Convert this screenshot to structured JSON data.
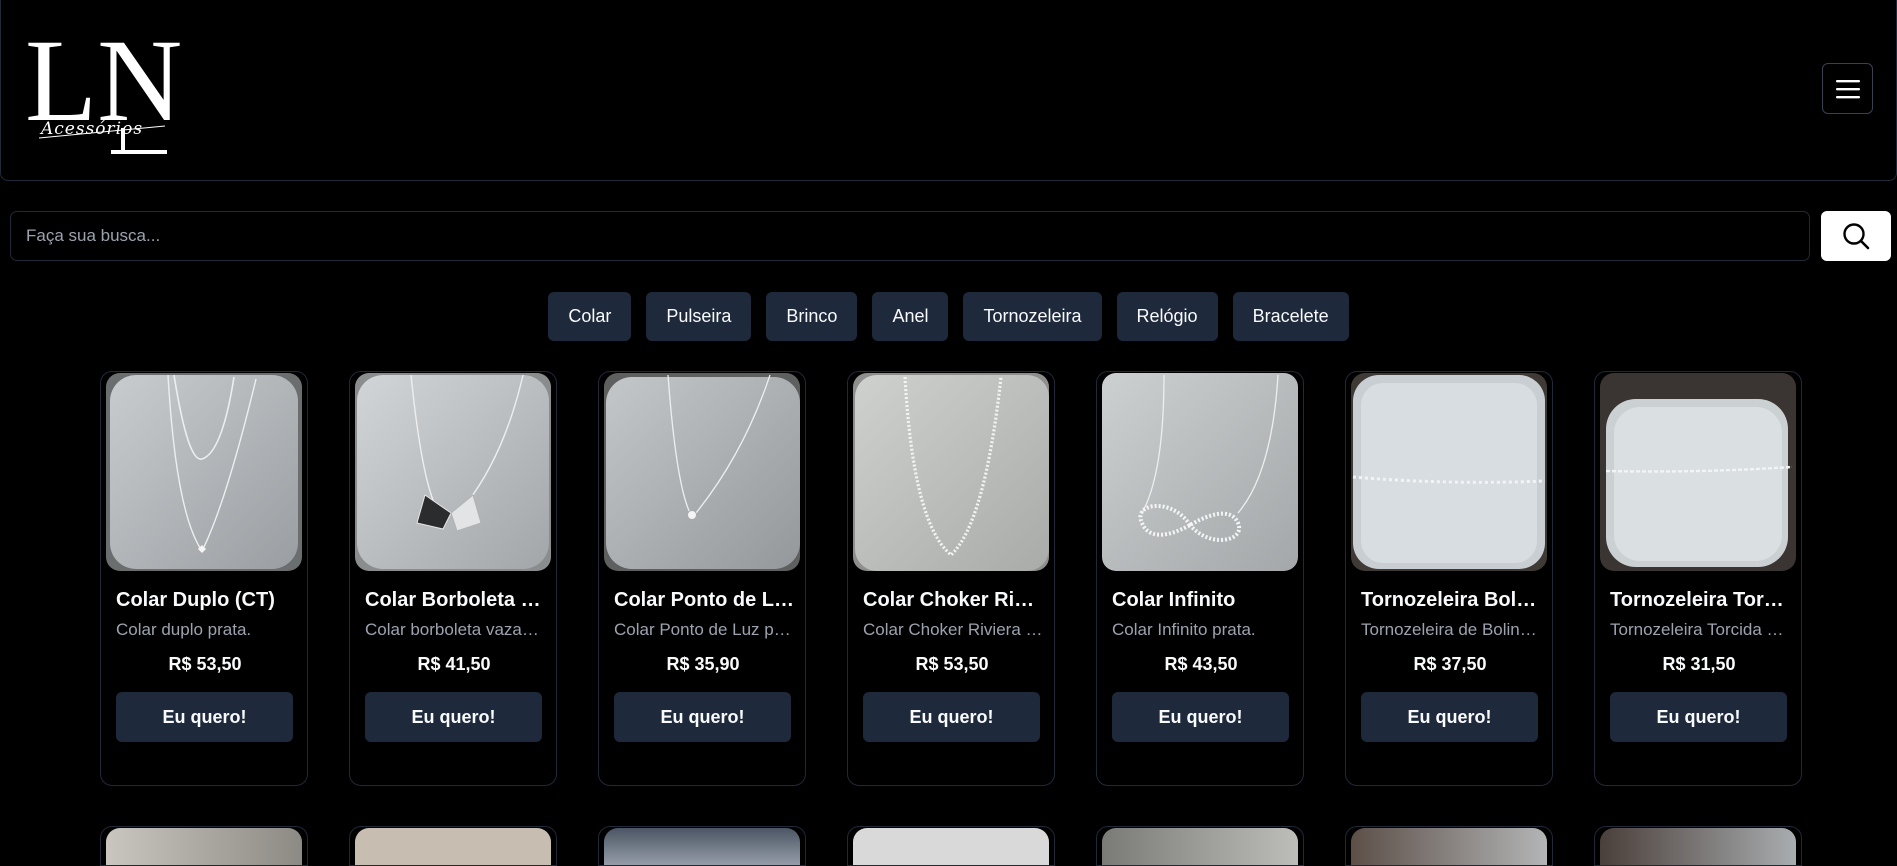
{
  "header": {
    "logo_letters": "LN",
    "logo_script": "Acessórios"
  },
  "search": {
    "placeholder": "Faça sua busca...",
    "value": ""
  },
  "categories": [
    "Colar",
    "Pulseira",
    "Brinco",
    "Anel",
    "Tornozeleira",
    "Relógio",
    "Bracelete"
  ],
  "products": [
    {
      "name": "Colar Duplo (CT)",
      "desc": "Colar duplo prata.",
      "price": "R$ 53,50",
      "cta": "Eu quero!",
      "photo": "double-necklace"
    },
    {
      "name": "Colar Borboleta Vazada",
      "desc": "Colar borboleta vazada prata.",
      "price": "R$ 41,50",
      "cta": "Eu quero!",
      "photo": "butterfly-necklace"
    },
    {
      "name": "Colar Ponto de Luz",
      "desc": "Colar Ponto de Luz prata.",
      "price": "R$ 35,90",
      "cta": "Eu quero!",
      "photo": "point-light-necklace"
    },
    {
      "name": "Colar Choker Riviera",
      "desc": "Colar Choker Riviera prata.",
      "price": "R$ 53,50",
      "cta": "Eu quero!",
      "photo": "choker-necklace"
    },
    {
      "name": "Colar Infinito",
      "desc": "Colar Infinito prata.",
      "price": "R$ 43,50",
      "cta": "Eu quero!",
      "photo": "infinity-necklace"
    },
    {
      "name": "Tornozeleira Bolinhas",
      "desc": "Tornozeleira de Bolinhas prata.",
      "price": "R$ 37,50",
      "cta": "Eu quero!",
      "photo": "anklet-beads"
    },
    {
      "name": "Tornozeleira Torcida",
      "desc": "Tornozeleira Torcida prata.",
      "price": "R$ 31,50",
      "cta": "Eu quero!",
      "photo": "anklet-twisted"
    }
  ],
  "colors": {
    "background": "#000000",
    "button_bg": "#1e293b",
    "border": "#1f2937",
    "muted_text": "#9ca3af"
  }
}
